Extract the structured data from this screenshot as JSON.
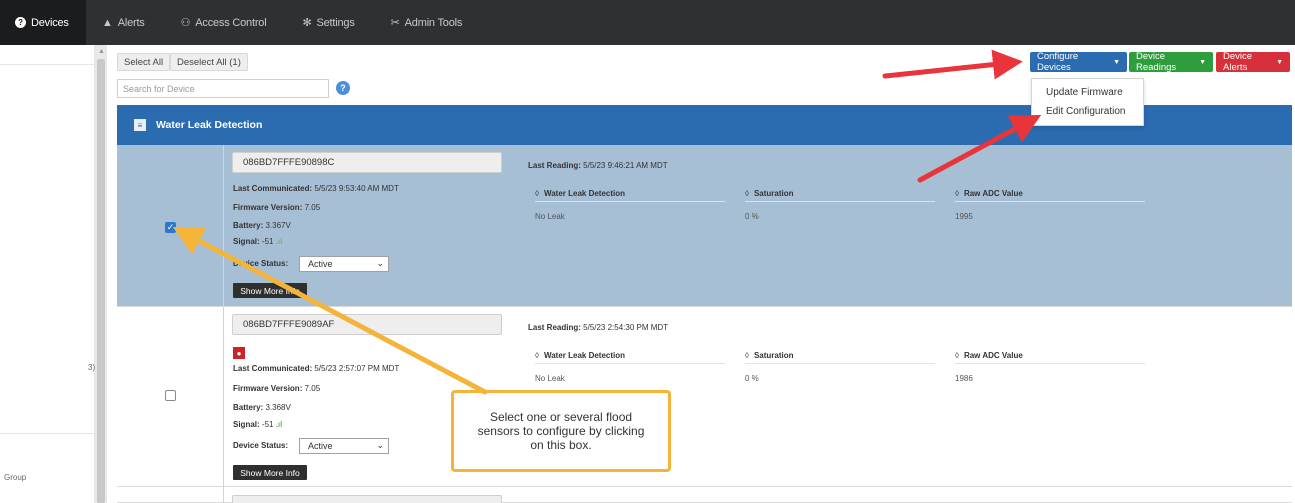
{
  "nav": {
    "devices": "Devices",
    "alerts": "Alerts",
    "access_control": "Access Control",
    "settings": "Settings",
    "admin_tools": "Admin Tools"
  },
  "sidebar": {
    "text1": "3)",
    "text2": "Group"
  },
  "toolbar": {
    "select_all": "Select All",
    "deselect_all": "Deselect All (1)",
    "search_placeholder": "Search for Device",
    "configure_devices": "Configure Devices",
    "device_readings": "Device Readings",
    "device_alerts": "Device Alerts"
  },
  "dropdown": {
    "items": [
      "Update Firmware",
      "Edit Configuration"
    ]
  },
  "group": {
    "title": "Water Leak Detection"
  },
  "devices": [
    {
      "id": "086BD7FFFE90898C",
      "selected": true,
      "last_communicated_label": "Last Communicated:",
      "last_communicated": "5/5/23 9:53:40 AM MDT",
      "firmware_label": "Firmware Version:",
      "firmware": "7.05",
      "battery_label": "Battery:",
      "battery": "3.367V",
      "signal_label": "Signal:",
      "signal": "-51",
      "status_label": "Device Status:",
      "status": "Active",
      "more_info": "Show More Info",
      "last_reading_label": "Last Reading:",
      "last_reading": "5/5/23 9:46:21 AM MDT",
      "readings": [
        {
          "label": "Water Leak Detection",
          "value": "No Leak"
        },
        {
          "label": "Saturation",
          "value": "0 %"
        },
        {
          "label": "Raw ADC Value",
          "value": "1995"
        }
      ]
    },
    {
      "id": "086BD7FFFE9089AF",
      "selected": false,
      "last_communicated_label": "Last Communicated:",
      "last_communicated": "5/5/23 2:57:07 PM MDT",
      "firmware_label": "Firmware Version:",
      "firmware": "7.05",
      "battery_label": "Battery:",
      "battery": "3.368V",
      "signal_label": "Signal:",
      "signal": "-51",
      "status_label": "Device Status:",
      "status": "Active",
      "more_info": "Show More Info",
      "last_reading_label": "Last Reading:",
      "last_reading": "5/5/23 2:54:30 PM MDT",
      "readings": [
        {
          "label": "Water Leak Detection",
          "value": "No Leak"
        },
        {
          "label": "Saturation",
          "value": "0 %"
        },
        {
          "label": "Raw ADC Value",
          "value": "1986"
        }
      ]
    }
  ],
  "callout": {
    "text": "Select one or several flood sensors to configure by clicking on this box."
  },
  "colors": {
    "nav_bg": "#2e3032",
    "primary_blue": "#2b6cb0",
    "green": "#2e9e3d",
    "red": "#d6303a",
    "selected_row": "#a7bfd4",
    "callout_border": "#f4b43a",
    "arrow_red": "#e8343a"
  }
}
